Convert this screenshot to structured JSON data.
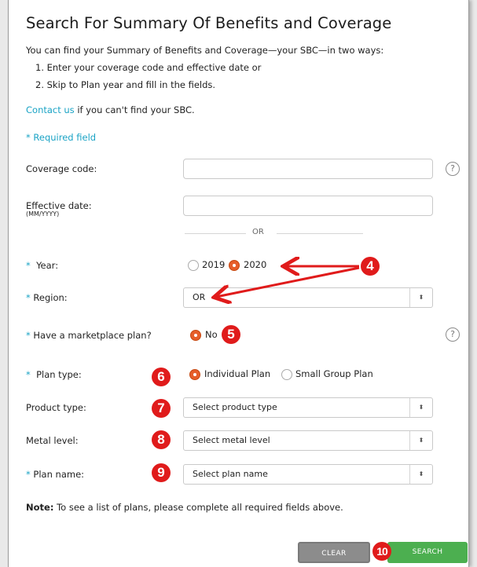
{
  "header": {
    "title": "Search For Summary Of Benefits and Coverage"
  },
  "intro": {
    "line1": "You can find your Summary of Benefits and Coverage—your SBC—in two ways:",
    "step1": "1. Enter your coverage code and effective date or",
    "step2": "2. Skip to Plan year and fill in the fields.",
    "contact_link": "Contact us",
    "contact_rest": " if you can't find your SBC.",
    "required_note": "* Required field"
  },
  "form": {
    "coverage_code": {
      "label": "Coverage code:",
      "value": ""
    },
    "effective_date": {
      "label": "Effective date:",
      "sublabel": "(MM/YYYY)",
      "value": ""
    },
    "or_text": "OR",
    "year": {
      "label": "Year:",
      "options": [
        "2019",
        "2020"
      ],
      "selected": "2020"
    },
    "region": {
      "label": "Region:",
      "value": "OR"
    },
    "marketplace": {
      "label": "Have a marketplace plan?",
      "options": [
        "No"
      ],
      "selected": "No"
    },
    "plan_type": {
      "label": "Plan type:",
      "options": [
        "Individual Plan",
        "Small Group Plan"
      ],
      "selected": "Individual Plan"
    },
    "product_type": {
      "label": "Product type:",
      "value": "Select product type"
    },
    "metal_level": {
      "label": "Metal level:",
      "value": "Select metal level"
    },
    "plan_name": {
      "label": "Plan name:",
      "value": "Select plan name"
    },
    "required_marker": "*",
    "help_glyph": "?",
    "select_arrow_glyph": "⬍"
  },
  "note": {
    "bold": "Note:",
    "text": " To see a list of plans, please complete all required fields above."
  },
  "buttons": {
    "clear": "CLEAR",
    "search": "SEARCH"
  },
  "callouts": [
    "4",
    "5",
    "6",
    "7",
    "8",
    "9",
    "10"
  ],
  "colors": {
    "accent": "#1aa3c5",
    "radio_selected": "#e65e2a",
    "callout": "#e01b1b",
    "search_button": "#4caf50",
    "clear_button": "#8c8c8c"
  }
}
